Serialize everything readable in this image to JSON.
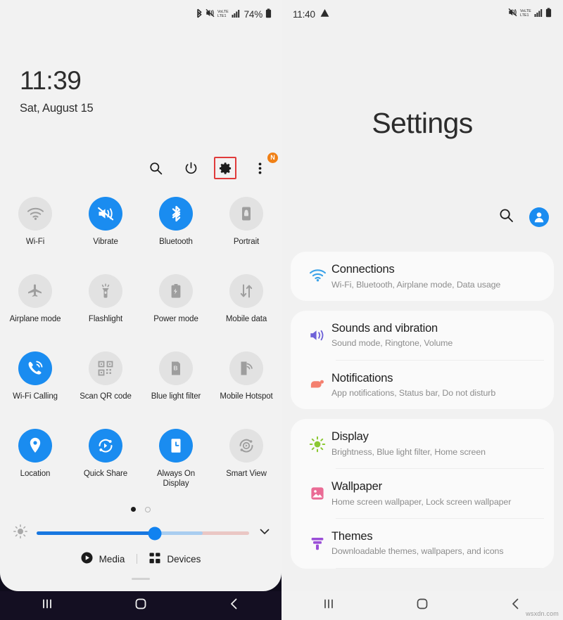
{
  "quick_panel": {
    "status_bar": {
      "icons": [
        "bluetooth-icon",
        "mute-vibrate-icon",
        "volte-icon",
        "signal-bars-icon",
        "battery-icon"
      ],
      "battery_percent": "74%"
    },
    "clock": {
      "time": "11:39",
      "date": "Sat, August 15"
    },
    "actions": [
      {
        "name": "search-icon",
        "label": "Search"
      },
      {
        "name": "power-icon",
        "label": "Power off"
      },
      {
        "name": "gear-icon",
        "label": "Settings",
        "highlighted": true
      },
      {
        "name": "more-options-icon",
        "label": "More options",
        "badge": "N"
      }
    ],
    "tiles": [
      {
        "label": "Wi-Fi",
        "icon": "wifi-icon",
        "active": false
      },
      {
        "label": "Vibrate",
        "icon": "vibrate-icon",
        "active": true
      },
      {
        "label": "Bluetooth",
        "icon": "bluetooth-icon",
        "active": true
      },
      {
        "label": "Portrait",
        "icon": "portrait-lock-icon",
        "active": false
      },
      {
        "label": "Airplane mode",
        "icon": "airplane-icon",
        "active": false
      },
      {
        "label": "Flashlight",
        "icon": "flashlight-icon",
        "active": false
      },
      {
        "label": "Power mode",
        "icon": "power-mode-icon",
        "active": false
      },
      {
        "label": "Mobile data",
        "icon": "mobile-data-icon",
        "active": false
      },
      {
        "label": "Wi-Fi Calling",
        "icon": "wifi-calling-icon",
        "active": true
      },
      {
        "label": "Scan QR code",
        "icon": "qr-code-icon",
        "active": false
      },
      {
        "label": "Blue light filter",
        "icon": "blue-light-filter-icon",
        "active": false
      },
      {
        "label": "Mobile Hotspot",
        "icon": "mobile-hotspot-icon",
        "active": false
      },
      {
        "label": "Location",
        "icon": "location-pin-icon",
        "active": true
      },
      {
        "label": "Quick Share",
        "icon": "quick-share-icon",
        "active": true
      },
      {
        "label": "Always On Display",
        "icon": "always-on-display-icon",
        "active": true
      },
      {
        "label": "Smart View",
        "icon": "smart-view-icon",
        "active": false
      }
    ],
    "pager": {
      "pages": 2,
      "current": 1
    },
    "brightness": {
      "icon": "brightness-icon",
      "value_percent": 55,
      "expand_icon": "chevron-down-icon"
    },
    "footer": {
      "media_label": "Media",
      "media_icon": "play-circle-icon",
      "devices_label": "Devices",
      "devices_icon": "devices-grid-icon"
    },
    "nav_bar": {
      "recents": "recents-icon",
      "home": "home-icon",
      "back": "back-icon"
    }
  },
  "settings": {
    "status_bar": {
      "time": "11:40",
      "warning_icon": "warning-triangle-icon",
      "icons": [
        "mute-vibrate-icon",
        "volte-icon",
        "signal-bars-icon",
        "battery-icon"
      ]
    },
    "title": "Settings",
    "toolbar": {
      "search_icon": "search-icon",
      "account_icon": "account-avatar-icon"
    },
    "groups": [
      {
        "items": [
          {
            "title": "Connections",
            "subtitle": "Wi-Fi, Bluetooth, Airplane mode, Data usage",
            "icon": "connections-wifi-icon",
            "color": "#3ba2e8"
          }
        ]
      },
      {
        "items": [
          {
            "title": "Sounds and vibration",
            "subtitle": "Sound mode, Ringtone, Volume",
            "icon": "sound-speaker-icon",
            "color": "#6f63d8"
          },
          {
            "title": "Notifications",
            "subtitle": "App notifications, Status bar, Do not disturb",
            "icon": "notifications-icon",
            "color": "#f4806f"
          }
        ]
      },
      {
        "items": [
          {
            "title": "Display",
            "subtitle": "Brightness, Blue light filter, Home screen",
            "icon": "display-brightness-icon",
            "color": "#8bc832"
          },
          {
            "title": "Wallpaper",
            "subtitle": "Home screen wallpaper, Lock screen wallpaper",
            "icon": "wallpaper-image-icon",
            "color": "#ea6b95"
          },
          {
            "title": "Themes",
            "subtitle": "Downloadable themes, wallpapers, and icons",
            "icon": "themes-brush-icon",
            "color": "#9b4fd8"
          }
        ]
      }
    ],
    "nav_bar": {
      "recents": "recents-icon",
      "home": "home-icon",
      "back": "back-icon"
    }
  },
  "watermark": "wsxdn.com",
  "colors": {
    "accent_blue": "#1a8cf0",
    "highlight_red": "#e03b3b",
    "badge_orange": "#f08016"
  }
}
